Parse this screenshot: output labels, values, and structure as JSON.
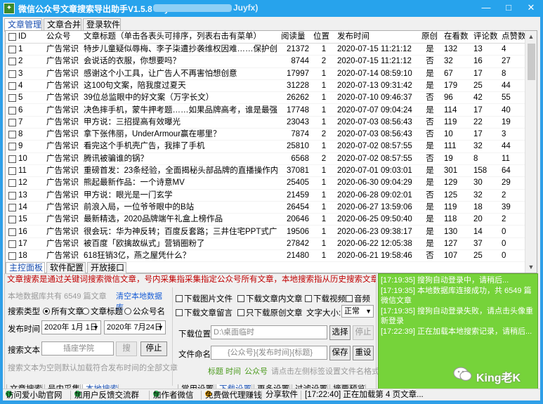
{
  "window": {
    "title": "微信公众号文章搜索导出助手V1.5.8",
    "title_by": "by:",
    "title_suffix": "Juyfx)",
    "app_icon": "app-icon",
    "minimize_icon": "—",
    "maximize_icon": "□",
    "close_icon": "✕"
  },
  "top_tabs": [
    "文章管理",
    "文章合并",
    "登录软件"
  ],
  "table": {
    "headers": [
      "ID",
      "公众号",
      "文章标题（单击各表头可排序，列表右击有菜单）",
      "阅读量",
      "位置",
      "发布时间",
      "原创",
      "在看数",
      "评论数",
      "点赞数"
    ],
    "rows": [
      [
        "1",
        "广告常识",
        "特步儿童疑似辱梅、李子柒遭抄袭维权因难……保护创意真...",
        "21372",
        "1",
        "2020-07-15 11:21:12",
        "是",
        "132",
        "13",
        "4"
      ],
      [
        "2",
        "广告常识",
        "会说话的衣服，你想要吗？",
        "8744",
        "2",
        "2020-07-15 11:21:12",
        "否",
        "32",
        "16",
        "27"
      ],
      [
        "3",
        "广告常识",
        "感谢这个小工具，让广告人不再害怕想创意",
        "17997",
        "1",
        "2020-07-14 08:59:10",
        "是",
        "67",
        "17",
        "8"
      ],
      [
        "4",
        "广告常识",
        "这100句文案，陪我度过夏天",
        "31228",
        "1",
        "2020-07-13 09:31:42",
        "是",
        "179",
        "25",
        "44"
      ],
      [
        "5",
        "广告常识",
        "39位总监眼中的好文案（万字长文）",
        "26262",
        "1",
        "2020-07-10 09:46:37",
        "否",
        "96",
        "42",
        "55"
      ],
      [
        "6",
        "广告常识",
        "决色摔手机，蒙牛押考题……如果品牌高考，谁是最强考试...",
        "17748",
        "1",
        "2020-07-07 09:04:24",
        "是",
        "114",
        "17",
        "40"
      ],
      [
        "7",
        "广告常识",
        "甲方说：三招提高有效曝光",
        "23043",
        "1",
        "2020-07-03 08:56:43",
        "否",
        "119",
        "22",
        "19"
      ],
      [
        "8",
        "广告常识",
        "拿下张伟丽，UnderArmour赢在哪里？",
        "7874",
        "2",
        "2020-07-03 08:56:43",
        "否",
        "10",
        "17",
        "3"
      ],
      [
        "9",
        "广告常识",
        "看完这个手机壳广告，我摔了手机",
        "25810",
        "1",
        "2020-07-02 08:57:55",
        "是",
        "111",
        "32",
        "44"
      ],
      [
        "10",
        "广告常识",
        "腾讯被骗谁的锅？",
        "6568",
        "2",
        "2020-07-02 08:57:55",
        "否",
        "19",
        "8",
        "11"
      ],
      [
        "11",
        "广告常识",
        "重磅首发：23条经验，全面揭秘头部品牌的直播操作内幕...",
        "37081",
        "1",
        "2020-07-01 09:03:01",
        "是",
        "301",
        "158",
        "64"
      ],
      [
        "12",
        "广告常识",
        "熊起最新作品：一个诗意MV",
        "25405",
        "1",
        "2020-06-30 09:04:29",
        "是",
        "129",
        "30",
        "29"
      ],
      [
        "13",
        "广告常识",
        "甲方说：眼光是一门玄学",
        "21459",
        "1",
        "2020-06-28 09:02:01",
        "否",
        "125",
        "32",
        "2"
      ],
      [
        "14",
        "广告常识",
        "前浪入局，一位爷爷眼中的B站",
        "26454",
        "1",
        "2020-06-27 13:59:06",
        "是",
        "119",
        "18",
        "39"
      ],
      [
        "15",
        "广告常识",
        "最新精选，2020品牌端午礼盒上榜作品",
        "20646",
        "1",
        "2020-06-25 09:50:40",
        "是",
        "118",
        "20",
        "2"
      ],
      [
        "16",
        "广告常识",
        "很会玩：华为神反转；百度反套路；三井住宅PPT式广告...",
        "19506",
        "1",
        "2020-06-23 09:38:17",
        "是",
        "130",
        "14",
        "0"
      ],
      [
        "17",
        "广告常识",
        "被百度「欧擒故纵式」营销圈粉了",
        "27842",
        "1",
        "2020-06-22 12:05:38",
        "是",
        "127",
        "37",
        "0"
      ],
      [
        "18",
        "广告常识",
        "618狂销3亿，燕之屋凭什么？",
        "21480",
        "1",
        "2020-06-21 19:58:46",
        "否",
        "107",
        "25",
        "0"
      ]
    ]
  },
  "panel_tabs": [
    "主控面板",
    "软件配置",
    "开放接口"
  ],
  "notice": "文章搜索是通过关键词搜索微信文章，号内采集指采集指定公众号所有文章，本地搜索指从历史搜索文章中按条件加载",
  "local": {
    "db_info": "本地数据库共有 6549 篇文章",
    "clear_link": "清空本地数据库",
    "search_type_label": "搜索类型",
    "radio_all": "所有文章",
    "radio_title": "文章标题",
    "radio_account": "公众号名",
    "date_label": "发布时间",
    "date_from": "2020年 1月 1日",
    "date_to": "2020年 7月24日",
    "search_text_label": "搜索文本",
    "search_text_value": "插座学院",
    "search_button": "搜",
    "stop_button": "停止",
    "hint": "搜索文本为空则默认加载符合发布时间的全部文章"
  },
  "left_bottom_tabs": [
    "文章搜索",
    "号内采集",
    "本地搜索"
  ],
  "download": {
    "cb_images": "下载图片文件",
    "cb_content": "下载文章内文章",
    "cb_video": "下载视频",
    "cb_audio": "音频",
    "cb_comments": "下载文章留言",
    "cb_original": "只下载原创文章",
    "font_size_label": "文字大小:",
    "font_size_value": "正常",
    "location_label": "下载位置",
    "location_value": "D:\\桌面临时",
    "select_button": "选择",
    "pause_button": "停止",
    "filename_label": "文件命名",
    "filename_value": "{公众号}{发布时间}{标题}",
    "save_button": "保存",
    "reset_button": "重设",
    "tag1": "标题",
    "tag2": "时间",
    "tag3": "公众号",
    "tag_hint": "请点击左侧标签设置文件名格式"
  },
  "right_bottom_tabs": [
    "常用设置",
    "下载设置",
    "更多设置",
    "过滤设置",
    "摘要预览"
  ],
  "log": [
    "[17:19:35] 搜狗自动登录中，请稍后...",
    "[17:19:35] 本地数据库连接成功，共 6549 篇微信文章",
    "[17:19:35] 搜狗自动登录失败，请点击头像重新登录",
    "[17:22:39] 正在加载本地搜索记录，请稍后..."
  ],
  "statusbar": {
    "item1": "访问爱小助官网",
    "item2": "加用户反馈交流群",
    "item3": "加作者微信",
    "item4": "免费做代理赚钱",
    "item5": "分享软件",
    "status": "[17:22:40] 正在加载第 4 页文章..."
  },
  "watermark": "King老K"
}
